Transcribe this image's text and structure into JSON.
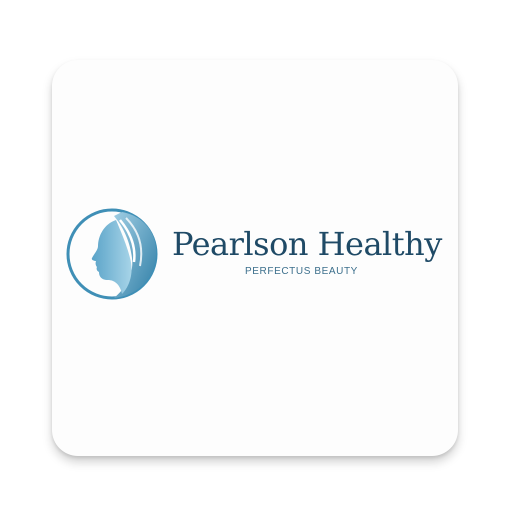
{
  "app_icon": {
    "brand_name": "Pearlson Healthy",
    "tagline": "PERFECTUS BEAUTY",
    "logo_icon": "woman-profile-icon",
    "colors": {
      "brand_text": "#1f4a66",
      "logo_blue": "#3f8fb6",
      "logo_light": "#9fcde3",
      "background": "#fdfdfd"
    }
  }
}
